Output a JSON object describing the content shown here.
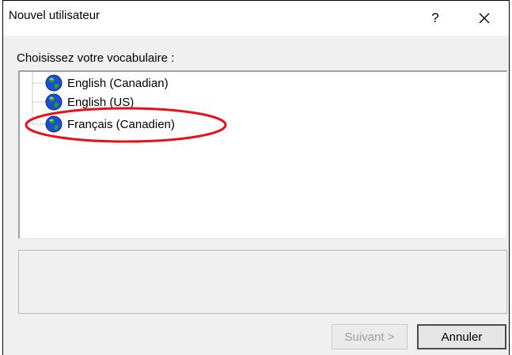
{
  "window": {
    "title": "Nouvel utilisateur",
    "help_label": "?"
  },
  "prompt": "Choisissez votre vocabulaire :",
  "vocabularies": [
    {
      "label": "English (Canadian)",
      "icon": "globe-icon"
    },
    {
      "label": "English (US)",
      "icon": "globe-icon"
    },
    {
      "label": "Français (Canadien)",
      "icon": "globe-icon",
      "highlighted": true
    }
  ],
  "buttons": {
    "next_label": "Suivant >",
    "next_enabled": false,
    "cancel_label": "Annuler"
  },
  "colors": {
    "highlight": "#e8101a",
    "globe_ocean": "#1a4fd0",
    "globe_land": "#2e9a2e"
  }
}
